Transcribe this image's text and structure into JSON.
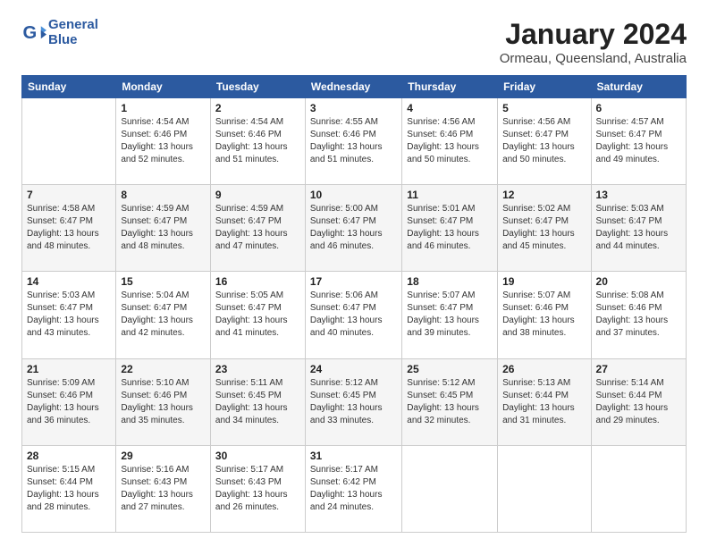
{
  "logo": {
    "line1": "General",
    "line2": "Blue"
  },
  "title": "January 2024",
  "subtitle": "Ormeau, Queensland, Australia",
  "weekdays": [
    "Sunday",
    "Monday",
    "Tuesday",
    "Wednesday",
    "Thursday",
    "Friday",
    "Saturday"
  ],
  "weeks": [
    [
      {
        "day": "",
        "info": ""
      },
      {
        "day": "1",
        "info": "Sunrise: 4:54 AM\nSunset: 6:46 PM\nDaylight: 13 hours\nand 52 minutes."
      },
      {
        "day": "2",
        "info": "Sunrise: 4:54 AM\nSunset: 6:46 PM\nDaylight: 13 hours\nand 51 minutes."
      },
      {
        "day": "3",
        "info": "Sunrise: 4:55 AM\nSunset: 6:46 PM\nDaylight: 13 hours\nand 51 minutes."
      },
      {
        "day": "4",
        "info": "Sunrise: 4:56 AM\nSunset: 6:46 PM\nDaylight: 13 hours\nand 50 minutes."
      },
      {
        "day": "5",
        "info": "Sunrise: 4:56 AM\nSunset: 6:47 PM\nDaylight: 13 hours\nand 50 minutes."
      },
      {
        "day": "6",
        "info": "Sunrise: 4:57 AM\nSunset: 6:47 PM\nDaylight: 13 hours\nand 49 minutes."
      }
    ],
    [
      {
        "day": "7",
        "info": "Sunrise: 4:58 AM\nSunset: 6:47 PM\nDaylight: 13 hours\nand 48 minutes."
      },
      {
        "day": "8",
        "info": "Sunrise: 4:59 AM\nSunset: 6:47 PM\nDaylight: 13 hours\nand 48 minutes."
      },
      {
        "day": "9",
        "info": "Sunrise: 4:59 AM\nSunset: 6:47 PM\nDaylight: 13 hours\nand 47 minutes."
      },
      {
        "day": "10",
        "info": "Sunrise: 5:00 AM\nSunset: 6:47 PM\nDaylight: 13 hours\nand 46 minutes."
      },
      {
        "day": "11",
        "info": "Sunrise: 5:01 AM\nSunset: 6:47 PM\nDaylight: 13 hours\nand 46 minutes."
      },
      {
        "day": "12",
        "info": "Sunrise: 5:02 AM\nSunset: 6:47 PM\nDaylight: 13 hours\nand 45 minutes."
      },
      {
        "day": "13",
        "info": "Sunrise: 5:03 AM\nSunset: 6:47 PM\nDaylight: 13 hours\nand 44 minutes."
      }
    ],
    [
      {
        "day": "14",
        "info": "Sunrise: 5:03 AM\nSunset: 6:47 PM\nDaylight: 13 hours\nand 43 minutes."
      },
      {
        "day": "15",
        "info": "Sunrise: 5:04 AM\nSunset: 6:47 PM\nDaylight: 13 hours\nand 42 minutes."
      },
      {
        "day": "16",
        "info": "Sunrise: 5:05 AM\nSunset: 6:47 PM\nDaylight: 13 hours\nand 41 minutes."
      },
      {
        "day": "17",
        "info": "Sunrise: 5:06 AM\nSunset: 6:47 PM\nDaylight: 13 hours\nand 40 minutes."
      },
      {
        "day": "18",
        "info": "Sunrise: 5:07 AM\nSunset: 6:47 PM\nDaylight: 13 hours\nand 39 minutes."
      },
      {
        "day": "19",
        "info": "Sunrise: 5:07 AM\nSunset: 6:46 PM\nDaylight: 13 hours\nand 38 minutes."
      },
      {
        "day": "20",
        "info": "Sunrise: 5:08 AM\nSunset: 6:46 PM\nDaylight: 13 hours\nand 37 minutes."
      }
    ],
    [
      {
        "day": "21",
        "info": "Sunrise: 5:09 AM\nSunset: 6:46 PM\nDaylight: 13 hours\nand 36 minutes."
      },
      {
        "day": "22",
        "info": "Sunrise: 5:10 AM\nSunset: 6:46 PM\nDaylight: 13 hours\nand 35 minutes."
      },
      {
        "day": "23",
        "info": "Sunrise: 5:11 AM\nSunset: 6:45 PM\nDaylight: 13 hours\nand 34 minutes."
      },
      {
        "day": "24",
        "info": "Sunrise: 5:12 AM\nSunset: 6:45 PM\nDaylight: 13 hours\nand 33 minutes."
      },
      {
        "day": "25",
        "info": "Sunrise: 5:12 AM\nSunset: 6:45 PM\nDaylight: 13 hours\nand 32 minutes."
      },
      {
        "day": "26",
        "info": "Sunrise: 5:13 AM\nSunset: 6:44 PM\nDaylight: 13 hours\nand 31 minutes."
      },
      {
        "day": "27",
        "info": "Sunrise: 5:14 AM\nSunset: 6:44 PM\nDaylight: 13 hours\nand 29 minutes."
      }
    ],
    [
      {
        "day": "28",
        "info": "Sunrise: 5:15 AM\nSunset: 6:44 PM\nDaylight: 13 hours\nand 28 minutes."
      },
      {
        "day": "29",
        "info": "Sunrise: 5:16 AM\nSunset: 6:43 PM\nDaylight: 13 hours\nand 27 minutes."
      },
      {
        "day": "30",
        "info": "Sunrise: 5:17 AM\nSunset: 6:43 PM\nDaylight: 13 hours\nand 26 minutes."
      },
      {
        "day": "31",
        "info": "Sunrise: 5:17 AM\nSunset: 6:42 PM\nDaylight: 13 hours\nand 24 minutes."
      },
      {
        "day": "",
        "info": ""
      },
      {
        "day": "",
        "info": ""
      },
      {
        "day": "",
        "info": ""
      }
    ]
  ]
}
